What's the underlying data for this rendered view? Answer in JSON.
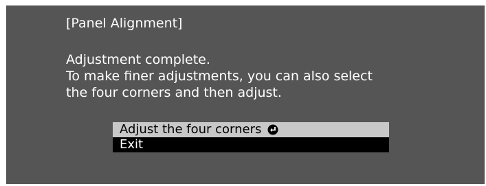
{
  "panel": {
    "title": "[Panel Alignment]",
    "message_lines": [
      "Adjustment complete.",
      "To make finer adjustments, you can also select",
      "the four corners and then adjust."
    ]
  },
  "menu": {
    "items": [
      {
        "label": "Adjust the four corners",
        "icon": "enter-icon",
        "selected": true
      },
      {
        "label": "Exit",
        "selected": false
      }
    ]
  },
  "colors": {
    "panel_background": "#555555",
    "highlight_background": "#c8c8c8",
    "menu_background": "#000000",
    "text": "#ffffff"
  }
}
